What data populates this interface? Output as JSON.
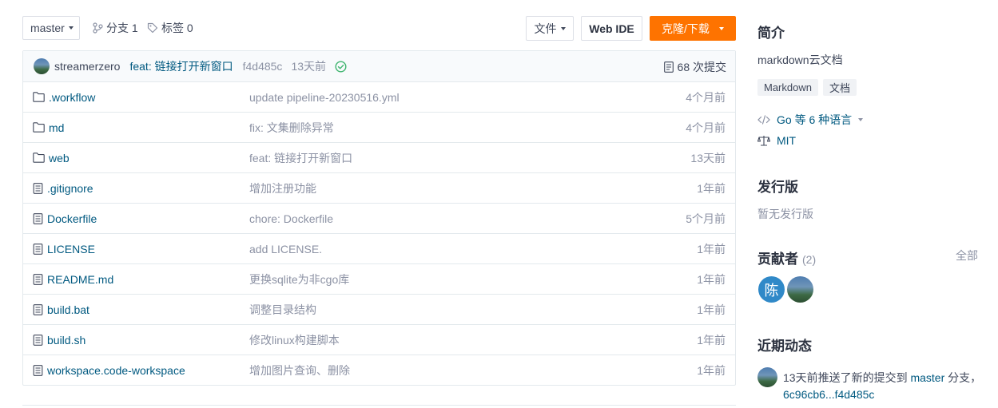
{
  "toolbar": {
    "branch": "master",
    "branches_label": "分支 1",
    "tags_label": "标签 0",
    "file_button": "文件",
    "webide_button": "Web IDE",
    "clone_button": "克隆/下载"
  },
  "commit": {
    "author": "streamerzero",
    "message": "feat: 链接打开新窗口",
    "hash": "f4d485c",
    "time": "13天前",
    "count_label": "68 次提交"
  },
  "files": [
    {
      "name": ".workflow",
      "type": "folder",
      "message": "update pipeline-20230516.yml",
      "time": "4个月前"
    },
    {
      "name": "md",
      "type": "folder",
      "message": "fix: 文集删除异常",
      "time": "4个月前"
    },
    {
      "name": "web",
      "type": "folder",
      "message": "feat: 链接打开新窗口",
      "time": "13天前"
    },
    {
      "name": ".gitignore",
      "type": "file",
      "message": "增加注册功能",
      "time": "1年前"
    },
    {
      "name": "Dockerfile",
      "type": "file",
      "message": "chore: Dockerfile",
      "time": "5个月前"
    },
    {
      "name": "LICENSE",
      "type": "file",
      "message": "add LICENSE.",
      "time": "1年前"
    },
    {
      "name": "README.md",
      "type": "file",
      "message": "更换sqlite为非cgo库",
      "time": "1年前"
    },
    {
      "name": "build.bat",
      "type": "file",
      "message": "调整目录结构",
      "time": "1年前"
    },
    {
      "name": "build.sh",
      "type": "file",
      "message": "修改linux构建脚本",
      "time": "1年前"
    },
    {
      "name": "workspace.code-workspace",
      "type": "file",
      "message": "增加图片查询、删除",
      "time": "1年前"
    }
  ],
  "sidebar": {
    "intro_title": "简介",
    "description": "markdown云文档",
    "tags": [
      "Markdown",
      "文档"
    ],
    "languages_label": "Go 等 6 种语言",
    "license": "MIT",
    "release_title": "发行版",
    "release_empty": "暂无发行版",
    "contrib_title": "贡献者",
    "contrib_count": "(2)",
    "contrib_all": "全部",
    "contributor_initial": "陈",
    "activity_title": "近期动态",
    "activity": {
      "prefix": "13天前推送了新的提交到",
      "branch": "master",
      "suffix": "分支，",
      "range": "6c96cb6...f4d485c"
    }
  },
  "colors": {
    "accent_orange": "#fe7300",
    "link_blue": "#005980",
    "success_green": "#3fb56f"
  }
}
